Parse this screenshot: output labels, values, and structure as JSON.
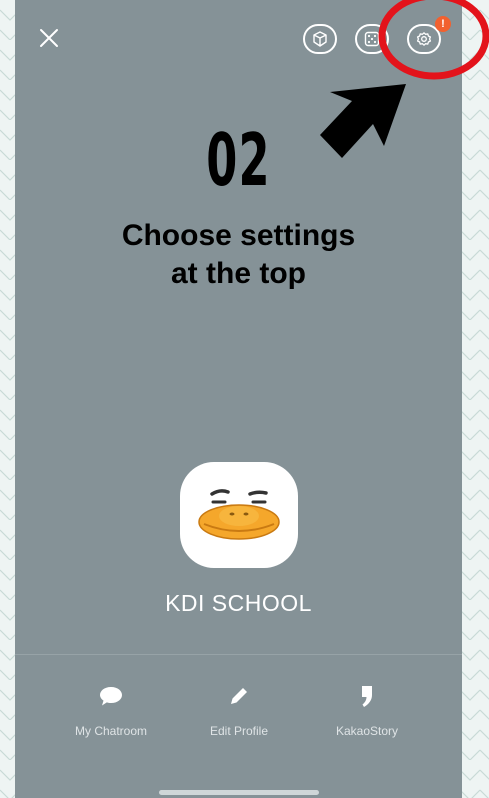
{
  "step": {
    "number": "02"
  },
  "instruction": {
    "line1": "Choose settings",
    "line2": "at the top"
  },
  "profile": {
    "name": "KDI SCHOOL",
    "avatar": "duck-character-avatar"
  },
  "topbar": {
    "close_icon": "close-icon",
    "buttons": [
      {
        "icon": "gift-box-icon"
      },
      {
        "icon": "dice-icon"
      },
      {
        "icon": "gear-icon",
        "badge": "!"
      }
    ]
  },
  "actions": [
    {
      "label": "My Chatroom",
      "icon": "chat-bubble-icon"
    },
    {
      "label": "Edit Profile",
      "icon": "pencil-icon"
    },
    {
      "label": "KakaoStory",
      "icon": "quote-icon"
    }
  ],
  "colors": {
    "screen_bg": "#859297",
    "badge": "#f2612f",
    "highlight_circle": "#e3131b",
    "arrow": "#000000"
  }
}
